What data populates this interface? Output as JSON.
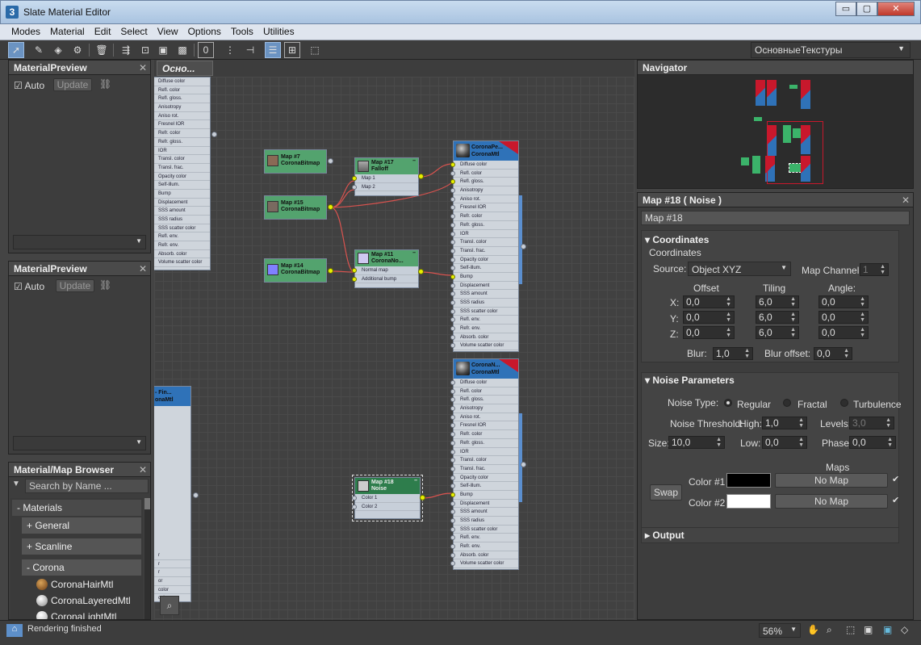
{
  "window": {
    "title": "Slate Material Editor",
    "app_icon": "3",
    "minimize": "▭",
    "restore": "▢",
    "close": "✕"
  },
  "menu": [
    "Modes",
    "Material",
    "Edit",
    "Select",
    "View",
    "Options",
    "Tools",
    "Utilities"
  ],
  "toolbar": {
    "view_dropdown": "ОсновныеТекстуры"
  },
  "preview1": {
    "title": "MaterialPreview",
    "auto_label": "Auto",
    "update_label": "Update"
  },
  "preview2": {
    "title": "MaterialPreview",
    "auto_label": "Auto",
    "update_label": "Update"
  },
  "browser": {
    "title": "Material/Map Browser",
    "search_placeholder": "Search by Name ...",
    "groups": {
      "materials": "Materials",
      "general": "General",
      "scanline": "Scanline",
      "corona": "Corona"
    },
    "items": [
      "CoronaHairMtl",
      "CoronaLayeredMtl",
      "CoronaLightMtl"
    ]
  },
  "view_tab": "Осно...",
  "nodes": {
    "map7": {
      "line1": "Map #7",
      "line2": "CoronaBitmap"
    },
    "map15": {
      "line1": "Map #15",
      "line2": "CoronaBitmap"
    },
    "map14": {
      "line1": "Map #14",
      "line2": "CoronaBitmap"
    },
    "map17": {
      "line1": "Map #17",
      "line2": "Falloff",
      "slots": [
        "Map 1",
        "Map 2"
      ]
    },
    "map11": {
      "line1": "Map #11",
      "line2": "CoronaNo...",
      "slots": [
        "Normal map",
        "Additional bump"
      ]
    },
    "map18": {
      "line1": "Map #18",
      "line2": "Noise",
      "slots": [
        "Color 1",
        "Color 2"
      ]
    },
    "mtl1": {
      "line1": "CoronaPe...",
      "line2": "CoronaMtl"
    },
    "mtl2": {
      "line1": "CoronaN...",
      "line2": "CoronaMtl"
    },
    "mtl_left": {
      "line1": "- Fin...",
      "line2": "onaMtl"
    },
    "mtl_slots": [
      "Diffuse color",
      "Refl. color",
      "Refl. gloss.",
      "Anisotropy",
      "Aniso rot.",
      "Fresnel IOR",
      "Refr. color",
      "Refr. gloss.",
      "IOR",
      "Transl. color",
      "Transl. frac.",
      "Opacity color",
      "Self-illum.",
      "Bump",
      "Displacement",
      "SSS amount",
      "SSS radius",
      "SSS scatter color",
      "Refl. env.",
      "Refr. env.",
      "Absorb. color",
      "Volume scatter color"
    ],
    "left_slots": [
      "Diffuse color",
      "Refl. color",
      "Refl. gloss.",
      "Anisotropy",
      "Aniso rot.",
      "Fresnel IOR",
      "Refr. color",
      "Refr. gloss.",
      "IOR",
      "Transl. color",
      "Transl. frac.",
      "Opacity color",
      "Self-illum.",
      "Bump",
      "Displacement",
      "SSS amount",
      "SSS radius",
      "SSS scatter color",
      "Refl. env.",
      "Refr. env.",
      "Absorb. color",
      "Volume scatter color"
    ],
    "left2_slots": [
      "r",
      "r",
      "r",
      "or",
      "color",
      "color",
      "color",
      "ter color"
    ]
  },
  "navigator": {
    "title": "Navigator"
  },
  "props": {
    "title": "Map #18  ( Noise )",
    "name_value": "Map #18",
    "coords": {
      "section": "Coordinates",
      "subheader": "Coordinates",
      "source_label": "Source:",
      "source_value": "Object XYZ",
      "map_channel_label": "Map Channel:",
      "map_channel_value": "1",
      "offset_label": "Offset",
      "tiling_label": "Tiling",
      "angle_label": "Angle:",
      "x_label": "X:",
      "y_label": "Y:",
      "z_label": "Z:",
      "offset": [
        "0,0",
        "0,0",
        "0,0"
      ],
      "tiling": [
        "6,0",
        "6,0",
        "6,0"
      ],
      "angle": [
        "0,0",
        "0,0",
        "0,0"
      ],
      "blur_label": "Blur:",
      "blur_value": "1,0",
      "blur_offset_label": "Blur offset:",
      "blur_offset_value": "0,0"
    },
    "noise": {
      "section": "Noise Parameters",
      "type_label": "Noise Type:",
      "types": [
        "Regular",
        "Fractal",
        "Turbulence"
      ],
      "selected_type": "Regular",
      "threshold_label": "Noise Threshold:",
      "high_label": "High:",
      "high_value": "1,0",
      "levels_label": "Levels:",
      "levels_value": "3,0",
      "size_label": "Size:",
      "size_value": "10,0",
      "low_label": "Low:",
      "low_value": "0,0",
      "phase_label": "Phase:",
      "phase_value": "0,0",
      "maps_label": "Maps",
      "swap_label": "Swap",
      "color1_label": "Color #1",
      "color1": "#000000",
      "color2_label": "Color #2",
      "color2": "#ffffff",
      "no_map_1": "No Map",
      "no_map_2": "No Map"
    },
    "output": {
      "section": "Output"
    }
  },
  "status": {
    "text": "Rendering finished",
    "zoom": "56%"
  },
  "colors": {
    "accent": "#2f72b8",
    "map_node": "#53a36e",
    "wire": "#d9534f",
    "nav_red": "#c8182c"
  }
}
